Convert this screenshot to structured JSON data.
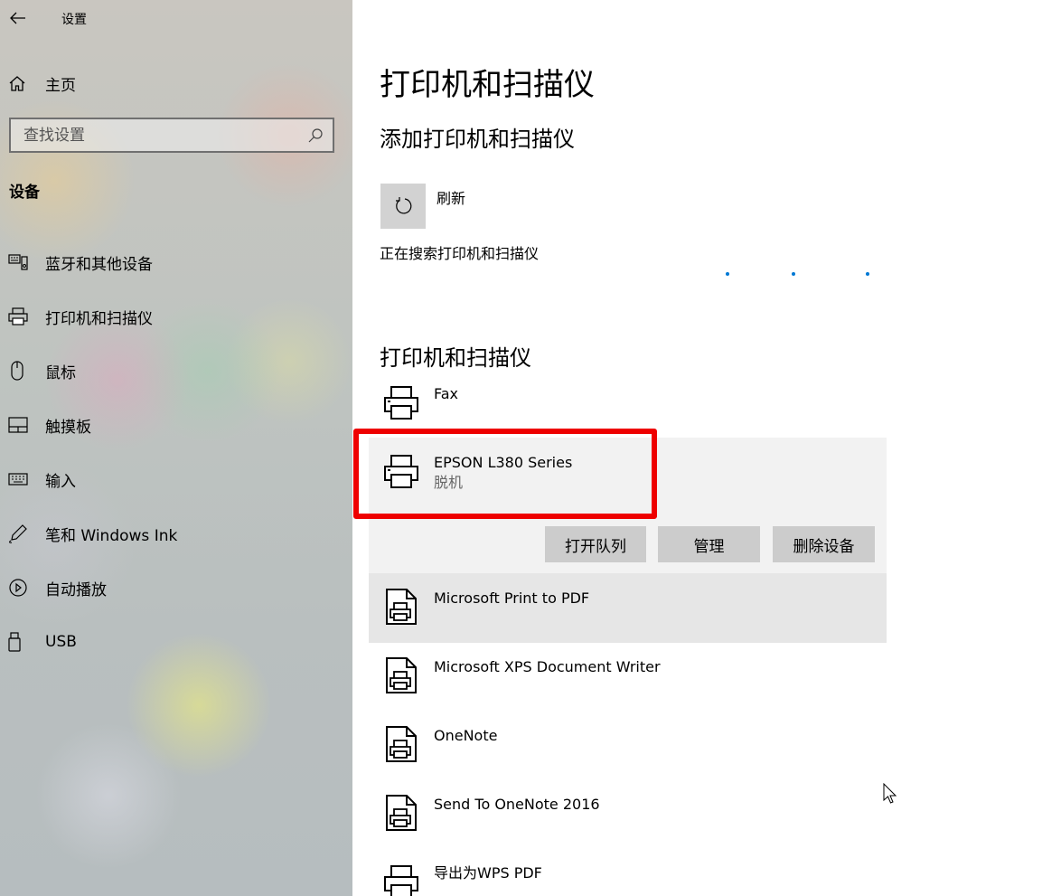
{
  "sidebar": {
    "app_title": "设置",
    "home_label": "主页",
    "search_placeholder": "查找设置",
    "section_heading": "设备",
    "items": [
      {
        "label": "蓝牙和其他设备",
        "icon": "bluetooth-devices-icon"
      },
      {
        "label": "打印机和扫描仪",
        "icon": "printer-icon"
      },
      {
        "label": "鼠标",
        "icon": "mouse-icon"
      },
      {
        "label": "触摸板",
        "icon": "touchpad-icon"
      },
      {
        "label": "输入",
        "icon": "keyboard-icon"
      },
      {
        "label": "笔和 Windows Ink",
        "icon": "pen-icon"
      },
      {
        "label": "自动播放",
        "icon": "autoplay-icon"
      },
      {
        "label": "USB",
        "icon": "usb-icon"
      }
    ]
  },
  "main": {
    "title": "打印机和扫描仪",
    "add_heading": "添加打印机和扫描仪",
    "refresh_label": "刷新",
    "searching_text": "正在搜索打印机和扫描仪",
    "list_heading": "打印机和扫描仪",
    "devices": [
      {
        "name": "Fax",
        "status": ""
      },
      {
        "name": "EPSON L380 Series",
        "status": "脱机"
      },
      {
        "name": "Microsoft Print to PDF",
        "status": ""
      },
      {
        "name": "Microsoft XPS Document Writer",
        "status": ""
      },
      {
        "name": "OneNote",
        "status": ""
      },
      {
        "name": "Send To OneNote 2016",
        "status": ""
      },
      {
        "name": "导出为WPS PDF",
        "status": ""
      }
    ],
    "actions": {
      "open_queue": "打开队列",
      "manage": "管理",
      "remove": "删除设备"
    }
  },
  "colors": {
    "accent": "#0078d4",
    "highlight_border": "#ee0000",
    "button_bg": "#cccccc",
    "expanded_bg": "#f2f2f2"
  }
}
